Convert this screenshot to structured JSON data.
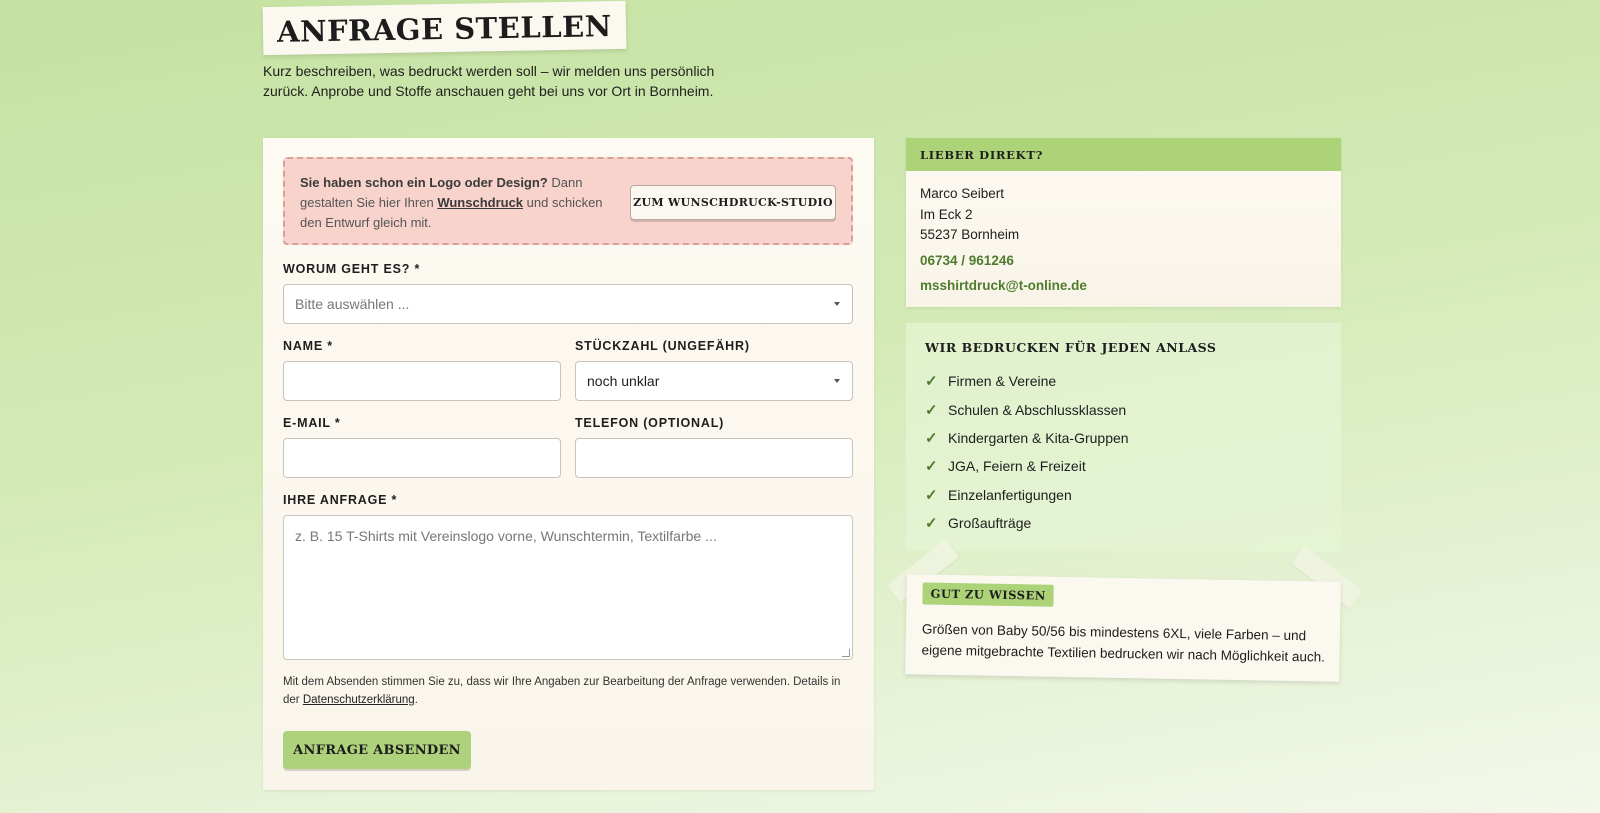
{
  "header": {
    "title": "ANFRAGE STELLEN",
    "intro": "Kurz beschreiben, was bedruckt werden soll – wir melden uns persönlich zurück. Anprobe und Stoffe anschauen geht bei uns vor Ort in Bornheim."
  },
  "studio": {
    "bold": "Sie haben schon ein Logo oder Design?",
    "text_before_link": " Dann gestalten Sie hier Ihren ",
    "link": "Wunschdruck",
    "text_after_link": " und schicken den Entwurf gleich mit.",
    "button": "ZUM WUNSCHDRUCK-STUDIO"
  },
  "form": {
    "topic_label": "WORUM GEHT ES? *",
    "topic_placeholder": "Bitte auswählen ...",
    "name_label": "NAME *",
    "quantity_label": "STÜCKZAHL (UNGEFÄHR)",
    "quantity_value": "noch unklar",
    "email_label": "E-MAIL *",
    "phone_label": "TELEFON (OPTIONAL)",
    "message_label": "IHRE ANFRAGE *",
    "message_placeholder": "z. B. 15 T-Shirts mit Vereinslogo vorne, Wunschtermin, Textilfarbe ...",
    "consent_text": "Mit dem Absenden stimmen Sie zu, dass wir Ihre Angaben zur Bearbeitung der Anfrage verwenden. Details in der ",
    "consent_link": "Datenschutzerklärung",
    "consent_end": ".",
    "submit": "ANFRAGE ABSENDEN"
  },
  "contact": {
    "heading": "LIEBER DIREKT?",
    "name": "Marco Seibert",
    "street": "Im Eck 2",
    "city": "55237 Bornheim",
    "phone": "06734 / 961246",
    "email": "msshirtdruck@t-online.de"
  },
  "occasions": {
    "title": "WIR BEDRUCKEN FÜR JEDEN ANLASS",
    "check_icon": "✓",
    "items": [
      "Firmen & Vereine",
      "Schulen & Abschlussklassen",
      "Kindergarten & Kita-Gruppen",
      "JGA, Feiern & Freizeit",
      "Einzelanfertigungen",
      "Großaufträge"
    ]
  },
  "note": {
    "badge": "GUT ZU WISSEN",
    "text": "Größen von Baby 50/56 bis mindestens 6XL, viele Farben – und eigene mitgebrachte Textilien bedrucken wir nach Möglichkeit auch."
  }
}
